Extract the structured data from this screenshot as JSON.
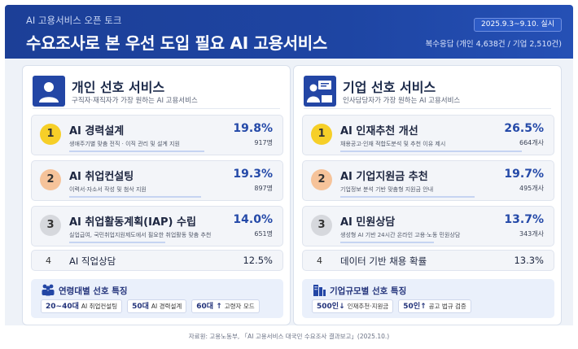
{
  "header": {
    "kicker": "AI 고용서비스 오픈 토크",
    "title": "수요조사로 본 우선 도입 필요 AI 고용서비스",
    "period": "2025.9.3~9.10. 실시",
    "sample": "복수응답 (개인 4,638건 / 기업 2,510건)"
  },
  "individual": {
    "icon": "person-icon",
    "title": "개인 선호 서비스",
    "subtitle": "구직자·재직자가 가장 원하는 AI 고용서비스",
    "items": [
      {
        "rank": "1",
        "name": "AI 경력설계",
        "desc": "생애주기별 맞춤 전직 · 이직 관리 및 설계 지원",
        "pct": "19.8%",
        "count": "917명",
        "share": 19.8
      },
      {
        "rank": "2",
        "name": "AI 취업컨설팅",
        "desc": "이력서·자소서 작성 및 첨삭 지원",
        "pct": "19.3%",
        "count": "897명",
        "share": 19.3
      },
      {
        "rank": "3",
        "name": "AI 취업활동계획(IAP) 수립",
        "desc": "실업급여, 국민취업지원제도에서 필요한 취업활동 맞춤 추천",
        "pct": "14.0%",
        "count": "651명",
        "share": 14.0
      }
    ],
    "fourth": {
      "rank": "4",
      "name": "AI 직업상담",
      "pct": "12.5%"
    },
    "feature": {
      "icon": "people-group-icon",
      "title": "연령대별 선호 특징",
      "chips": [
        {
          "strong": "20~40대",
          "text": "AI 취업컨설팅"
        },
        {
          "strong": "50대",
          "text": "AI 경력설계"
        },
        {
          "strong": "60대 ↑",
          "text": "고령자 모드"
        }
      ]
    }
  },
  "business": {
    "icon": "presenter-icon",
    "title": "기업 선호 서비스",
    "subtitle": "인사담당자가 가장 원하는 AI 고용서비스",
    "items": [
      {
        "rank": "1",
        "name": "AI 인재추천 개선",
        "desc": "채용공고·인재 적합도분석 및 추천 이유 제시",
        "pct": "26.5%",
        "count": "664개사",
        "share": 26.5
      },
      {
        "rank": "2",
        "name": "AI 기업지원금 추천",
        "desc": "기업정보 분석 기반 맞춤형 지원금 안내",
        "pct": "19.7%",
        "count": "495개사",
        "share": 19.7
      },
      {
        "rank": "3",
        "name": "AI 민원상담",
        "desc": "생성형 AI 기반 24시간 온라인 고용·노동 민원상담",
        "pct": "13.7%",
        "count": "343개사",
        "share": 13.7
      }
    ],
    "fourth": {
      "rank": "4",
      "name": "데이터 기반 채용 확률",
      "pct": "13.3%"
    },
    "feature": {
      "icon": "building-icon",
      "title": "기업규모별 선호 특징",
      "chips": [
        {
          "strong": "500인↓",
          "text": "인재추천·지원금"
        },
        {
          "strong": "50인↑",
          "text": "공고 법규 검증"
        }
      ]
    }
  },
  "footer": "자료원: 고용노동부, 「AI 고용서비스 대국민 수요조사 결과보고」(2025.10.)",
  "colors": {
    "header": "#1e45a3",
    "accent": "#2449a8",
    "rank1": "#f6cf28",
    "rank2": "#f6c39a",
    "rank3": "#d6d8dd"
  }
}
